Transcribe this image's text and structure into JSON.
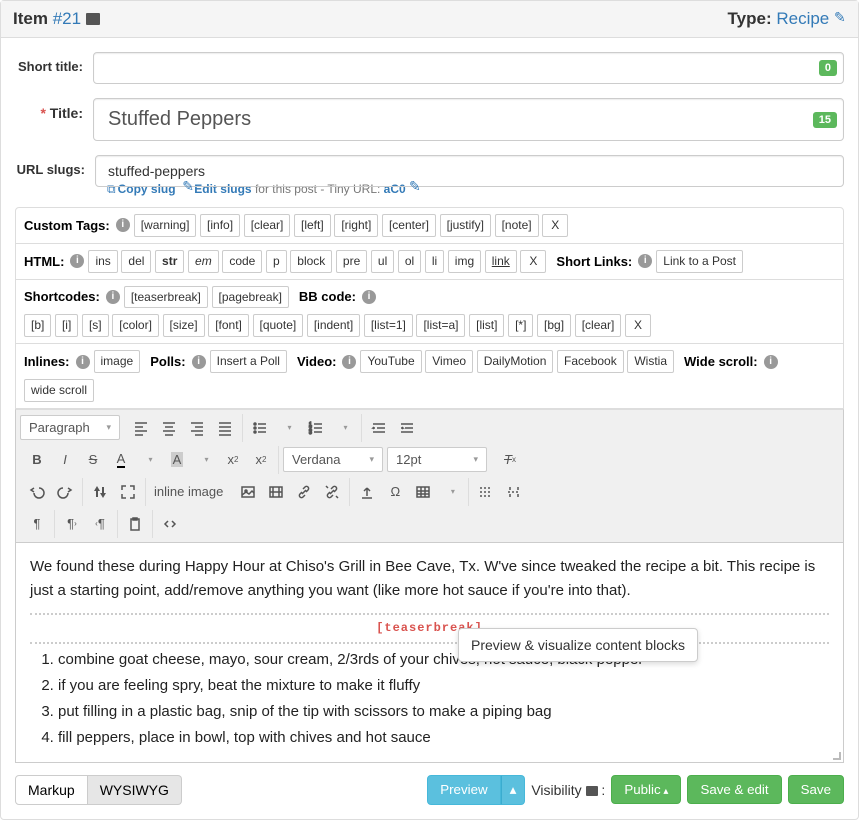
{
  "header": {
    "item_label": "Item",
    "item_number": "#21",
    "type_label": "Type:",
    "type_value": "Recipe"
  },
  "fields": {
    "short_title": {
      "label": "Short title:",
      "value": "",
      "count": "0"
    },
    "title": {
      "label": "Title:",
      "value": "Stuffed Peppers",
      "count": "15",
      "required": "*"
    },
    "slug": {
      "label": "URL slugs:",
      "value": "stuffed-peppers"
    },
    "slug_links": {
      "copy": "Copy slug",
      "edit": "Edit slugs",
      "post_text": "for this post - Tiny URL:",
      "tiny_url": "aC0"
    }
  },
  "toolbars": {
    "custom_tags": {
      "label": "Custom Tags:",
      "items": [
        "[warning]",
        "[info]",
        "[clear]",
        "[left]",
        "[right]",
        "[center]",
        "[justify]",
        "[note]",
        "X"
      ]
    },
    "html": {
      "label": "HTML:",
      "items": [
        "ins",
        "del",
        "str",
        "em",
        "code",
        "p",
        "block",
        "pre",
        "ul",
        "ol",
        "li",
        "img",
        "link",
        "X"
      ]
    },
    "short_links": {
      "label": "Short Links:",
      "button": "Link to a Post"
    },
    "shortcodes": {
      "label": "Shortcodes:",
      "items": [
        "[teaserbreak]",
        "[pagebreak]"
      ]
    },
    "bbcode": {
      "label": "BB code:",
      "items": [
        "[b]",
        "[i]",
        "[s]",
        "[color]",
        "[size]",
        "[font]",
        "[quote]",
        "[indent]",
        "[list=1]",
        "[list=a]",
        "[list]",
        "[*]",
        "[bg]",
        "[clear]",
        "X"
      ]
    },
    "inlines": {
      "label": "Inlines:",
      "button": "image"
    },
    "polls": {
      "label": "Polls:",
      "button": "Insert a Poll"
    },
    "video": {
      "label": "Video:",
      "items": [
        "YouTube",
        "Vimeo",
        "DailyMotion",
        "Facebook",
        "Wistia"
      ]
    },
    "wide_scroll": {
      "label": "Wide scroll:",
      "button": "wide scroll"
    }
  },
  "mce": {
    "format": "Paragraph",
    "inline_image": "inline image",
    "font": "Verdana",
    "size": "12pt"
  },
  "content": {
    "para": "We found these during Happy Hour at Chiso's Grill in Bee Cave, Tx. W've since tweaked the recipe a bit. This recipe is just a starting point, add/remove anything you want (like more hot sauce if you're into that).",
    "teaser": "[teaserbreak]",
    "steps": [
      "combine goat cheese, mayo, sour cream, 2/3rds of your chives, hot sauce, black pepper",
      "if you are feeling spry, beat the mixture to make it fluffy",
      "put filling in a plastic bag, snip of the tip with scissors to make a piping bag",
      "fill peppers, place in bowl, top with chives and hot sauce"
    ]
  },
  "footer": {
    "markup": "Markup",
    "wysiwyg": "WYSIWYG",
    "preview": "Preview",
    "visibility_label": "Visibility",
    "public": "Public",
    "save_edit": "Save & edit",
    "save": "Save",
    "tooltip": "Preview & visualize content blocks"
  }
}
